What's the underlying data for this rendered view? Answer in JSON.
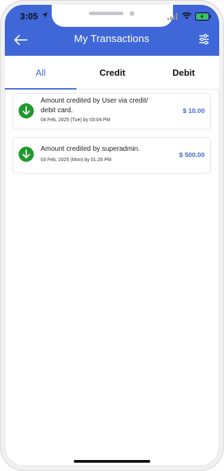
{
  "status_bar": {
    "time": "3:05"
  },
  "header": {
    "title": "My Transactions"
  },
  "tabs": [
    {
      "label": "All",
      "active": true
    },
    {
      "label": "Credit",
      "active": false
    },
    {
      "label": "Debit",
      "active": false
    }
  ],
  "transactions": [
    {
      "description": "Amount credited by User via credit/ debit card.",
      "date": "04 Feb, 2025 (Tue) by 03:04 PM",
      "amount": "$ 10.00",
      "icon": "arrow-down-icon"
    },
    {
      "description": "Amount credited by superadmin.",
      "date": "03 Feb, 2025 (Mon) by 01:26 PM",
      "amount": "$ 500.00",
      "icon": "arrow-down-icon"
    }
  ],
  "colors": {
    "accent": "#3f67d8",
    "credit_icon": "#1f9a2a"
  }
}
